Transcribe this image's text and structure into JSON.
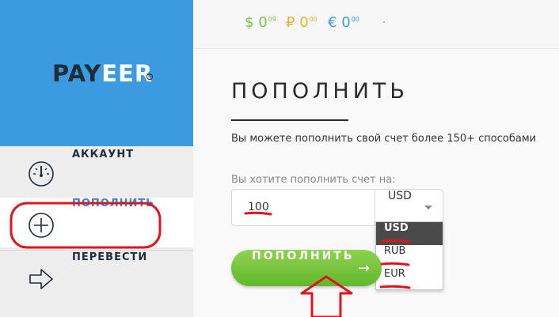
{
  "brand": {
    "logo_main": "PAY",
    "logo_accent": "EER",
    "logo_reg": "R"
  },
  "balances": {
    "usd": {
      "symbol": "$",
      "whole": "0",
      "cents": "09"
    },
    "rub": {
      "symbol": "₽",
      "whole": "0",
      "cents": "00"
    },
    "eur": {
      "symbol": "€",
      "whole": "0",
      "cents": "00"
    }
  },
  "sidebar": {
    "items": [
      {
        "label": "АККАУНТ",
        "icon": "speedometer-icon"
      },
      {
        "label": "ПОПОЛНИТЬ",
        "icon": "plus-circle-icon"
      },
      {
        "label": "ПЕРЕВЕСТИ",
        "icon": "arrow-right-icon"
      }
    ]
  },
  "main": {
    "title": "ПОПОЛНИТЬ",
    "description": "Вы можете пополнить свой счет более 150+ способами",
    "field_label": "Вы хотите пополнить счет на:",
    "amount_value": "100",
    "currency_value": "USD",
    "currency_options": [
      "USD",
      "RUB",
      "EUR"
    ],
    "submit_label": "ПОПОЛНИТЬ",
    "submit_arrow": "→"
  },
  "colors": {
    "sidebar_brand": "#3c9be0",
    "button_green": "#6cbf34",
    "annotation_red": "#e0141e",
    "usd_green": "#7cc14c",
    "rub_yellow": "#e6b23c",
    "eur_blue": "#3c9be0"
  }
}
